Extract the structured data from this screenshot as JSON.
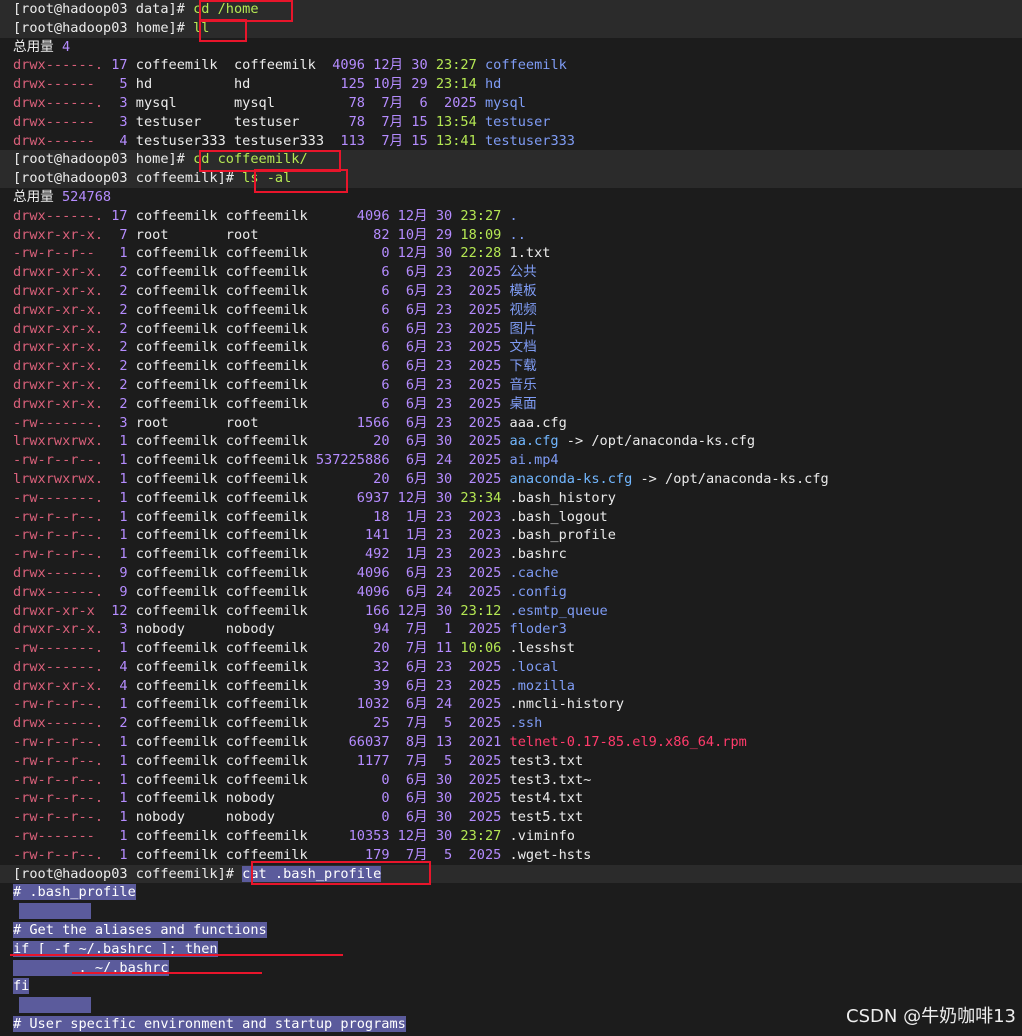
{
  "window": {
    "watermark": "CSDN @牛奶咖啡13"
  },
  "prompt1": {
    "text": "[root@hadoop03 data]# ",
    "cmd": "cd /home"
  },
  "prompt2": {
    "text": "[root@hadoop03 home]# ",
    "cmd": "ll"
  },
  "total1": {
    "label": "总用量",
    "value": "4"
  },
  "home_rows": [
    {
      "perm": "drwx------.",
      "links": "17",
      "user": "coffeemilk",
      "group": "coffeemilk",
      "size": "4096",
      "month": "12月",
      "day": "30",
      "time": "23:27",
      "name": "coffeemilk"
    },
    {
      "perm": "drwx------ ",
      "links": " 5",
      "user": "hd",
      "group": "hd",
      "size": "125",
      "month": "10月",
      "day": "29",
      "time": "23:14",
      "name": "hd"
    },
    {
      "perm": "drwx------.",
      "links": " 3",
      "user": "mysql",
      "group": "mysql",
      "size": "78",
      "month": "7月",
      "day": " 6",
      "time": " 2025",
      "name": "mysql"
    },
    {
      "perm": "drwx------ ",
      "links": " 3",
      "user": "testuser",
      "group": "testuser",
      "size": "78",
      "month": "7月",
      "day": "15",
      "time": "13:54",
      "name": "testuser"
    },
    {
      "perm": "drwx------ ",
      "links": " 4",
      "user": "testuser333",
      "group": "testuser333",
      "size": "113",
      "month": "7月",
      "day": "15",
      "time": "13:41",
      "name": "testuser333"
    }
  ],
  "prompt3": {
    "text": "[root@hadoop03 home]# ",
    "cmd": "cd coffeemilk/"
  },
  "prompt4": {
    "text": "[root@hadoop03 coffeemilk]# ",
    "cmd": "ls -al"
  },
  "total2": {
    "label": "总用量",
    "value": "524768"
  },
  "ls_rows": [
    {
      "perm": "drwx------.",
      "links": "17",
      "user": "coffeemilk",
      "group": "coffeemilk",
      "size": "4096",
      "month": "12月",
      "day": "30",
      "time": "23:27",
      "name": ".",
      "ncolor": "blue",
      "tcolor": "green"
    },
    {
      "perm": "drwxr-xr-x.",
      "links": " 7",
      "user": "root",
      "group": "root",
      "size": "82",
      "month": "10月",
      "day": "29",
      "time": "18:09",
      "name": "..",
      "ncolor": "blue",
      "tcolor": "green"
    },
    {
      "perm": "-rw-r--r--",
      "links": "1",
      "user": "coffeemilk",
      "group": "coffeemilk",
      "size": "0",
      "month": "12月",
      "day": "30",
      "time": "22:28",
      "name": "1.txt",
      "ncolor": "white",
      "tcolor": "green"
    },
    {
      "perm": "drwxr-xr-x.",
      "links": "2",
      "user": "coffeemilk",
      "group": "coffeemilk",
      "size": "6",
      "month": "6月",
      "day": "23",
      "time": "2025",
      "name": "公共",
      "ncolor": "blue",
      "tcolor": "purple"
    },
    {
      "perm": "drwxr-xr-x.",
      "links": "2",
      "user": "coffeemilk",
      "group": "coffeemilk",
      "size": "6",
      "month": "6月",
      "day": "23",
      "time": "2025",
      "name": "模板",
      "ncolor": "blue",
      "tcolor": "purple"
    },
    {
      "perm": "drwxr-xr-x.",
      "links": "2",
      "user": "coffeemilk",
      "group": "coffeemilk",
      "size": "6",
      "month": "6月",
      "day": "23",
      "time": "2025",
      "name": "视频",
      "ncolor": "blue",
      "tcolor": "purple"
    },
    {
      "perm": "drwxr-xr-x.",
      "links": "2",
      "user": "coffeemilk",
      "group": "coffeemilk",
      "size": "6",
      "month": "6月",
      "day": "23",
      "time": "2025",
      "name": "图片",
      "ncolor": "blue",
      "tcolor": "purple"
    },
    {
      "perm": "drwxr-xr-x.",
      "links": "2",
      "user": "coffeemilk",
      "group": "coffeemilk",
      "size": "6",
      "month": "6月",
      "day": "23",
      "time": "2025",
      "name": "文档",
      "ncolor": "blue",
      "tcolor": "purple"
    },
    {
      "perm": "drwxr-xr-x.",
      "links": "2",
      "user": "coffeemilk",
      "group": "coffeemilk",
      "size": "6",
      "month": "6月",
      "day": "23",
      "time": "2025",
      "name": "下载",
      "ncolor": "blue",
      "tcolor": "purple"
    },
    {
      "perm": "drwxr-xr-x.",
      "links": "2",
      "user": "coffeemilk",
      "group": "coffeemilk",
      "size": "6",
      "month": "6月",
      "day": "23",
      "time": "2025",
      "name": "音乐",
      "ncolor": "blue",
      "tcolor": "purple"
    },
    {
      "perm": "drwxr-xr-x.",
      "links": "2",
      "user": "coffeemilk",
      "group": "coffeemilk",
      "size": "6",
      "month": "6月",
      "day": "23",
      "time": "2025",
      "name": "桌面",
      "ncolor": "blue",
      "tcolor": "purple"
    },
    {
      "perm": "-rw-------.",
      "links": "3",
      "user": "root",
      "group": "root",
      "size": "1566",
      "month": "6月",
      "day": "23",
      "time": "2025",
      "name": "aaa.cfg",
      "ncolor": "white",
      "tcolor": "purple"
    },
    {
      "perm": "lrwxrwxrwx.",
      "links": "1",
      "user": "coffeemilk",
      "group": "coffeemilk",
      "size": "20",
      "month": "6月",
      "day": "30",
      "time": "2025",
      "name": "aa.cfg",
      "link": " -> /opt/anaconda-ks.cfg",
      "ncolor": "cyan",
      "tcolor": "purple"
    },
    {
      "perm": "-rw-r--r--.",
      "links": "1",
      "user": "coffeemilk",
      "group": "coffeemilk",
      "size": "537225886",
      "month": "6月",
      "day": "24",
      "time": "2025",
      "name": "ai.mp4",
      "ncolor": "blue",
      "tcolor": "purple"
    },
    {
      "perm": "lrwxrwxrwx.",
      "links": "1",
      "user": "coffeemilk",
      "group": "coffeemilk",
      "size": "20",
      "month": "6月",
      "day": "30",
      "time": "2025",
      "name": "anaconda-ks.cfg",
      "link": " -> /opt/anaconda-ks.cfg",
      "ncolor": "cyan",
      "tcolor": "purple"
    },
    {
      "perm": "-rw-------.",
      "links": "1",
      "user": "coffeemilk",
      "group": "coffeemilk",
      "size": "6937",
      "month": "12月",
      "day": "30",
      "time": "23:34",
      "name": ".bash_history",
      "ncolor": "white",
      "tcolor": "green"
    },
    {
      "perm": "-rw-r--r--.",
      "links": "1",
      "user": "coffeemilk",
      "group": "coffeemilk",
      "size": "18",
      "month": "1月",
      "day": "23",
      "time": "2023",
      "name": ".bash_logout",
      "ncolor": "white",
      "tcolor": "purple"
    },
    {
      "perm": "-rw-r--r--.",
      "links": "1",
      "user": "coffeemilk",
      "group": "coffeemilk",
      "size": "141",
      "month": "1月",
      "day": "23",
      "time": "2023",
      "name": ".bash_profile",
      "ncolor": "white",
      "tcolor": "purple"
    },
    {
      "perm": "-rw-r--r--.",
      "links": "1",
      "user": "coffeemilk",
      "group": "coffeemilk",
      "size": "492",
      "month": "1月",
      "day": "23",
      "time": "2023",
      "name": ".bashrc",
      "ncolor": "white",
      "tcolor": "purple"
    },
    {
      "perm": "drwx------.",
      "links": "9",
      "user": "coffeemilk",
      "group": "coffeemilk",
      "size": "4096",
      "month": "6月",
      "day": "23",
      "time": "2025",
      "name": ".cache",
      "ncolor": "blue",
      "tcolor": "purple"
    },
    {
      "perm": "drwx------.",
      "links": "9",
      "user": "coffeemilk",
      "group": "coffeemilk",
      "size": "4096",
      "month": "6月",
      "day": "24",
      "time": "2025",
      "name": ".config",
      "ncolor": "blue",
      "tcolor": "purple"
    },
    {
      "perm": "drwxr-xr-x",
      "links": "12",
      "user": "coffeemilk",
      "group": "coffeemilk",
      "size": "166",
      "month": "12月",
      "day": "30",
      "time": "23:12",
      "name": ".esmtp_queue",
      "ncolor": "blue",
      "tcolor": "green"
    },
    {
      "perm": "drwxr-xr-x.",
      "links": "3",
      "user": "nobody",
      "group": "nobody",
      "size": "94",
      "month": "7月",
      "day": "1",
      "time": "2025",
      "name": "floder3",
      "ncolor": "blue",
      "tcolor": "purple"
    },
    {
      "perm": "-rw-------.",
      "links": "1",
      "user": "coffeemilk",
      "group": "coffeemilk",
      "size": "20",
      "month": "7月",
      "day": "11",
      "time": "10:06",
      "name": ".lesshst",
      "ncolor": "white",
      "tcolor": "green"
    },
    {
      "perm": "drwx------.",
      "links": "4",
      "user": "coffeemilk",
      "group": "coffeemilk",
      "size": "32",
      "month": "6月",
      "day": "23",
      "time": "2025",
      "name": ".local",
      "ncolor": "blue",
      "tcolor": "purple"
    },
    {
      "perm": "drwxr-xr-x.",
      "links": "4",
      "user": "coffeemilk",
      "group": "coffeemilk",
      "size": "39",
      "month": "6月",
      "day": "23",
      "time": "2025",
      "name": ".mozilla",
      "ncolor": "blue",
      "tcolor": "purple"
    },
    {
      "perm": "-rw-r--r--.",
      "links": "1",
      "user": "coffeemilk",
      "group": "coffeemilk",
      "size": "1032",
      "month": "6月",
      "day": "24",
      "time": "2025",
      "name": ".nmcli-history",
      "ncolor": "white",
      "tcolor": "purple"
    },
    {
      "perm": "drwx------.",
      "links": "2",
      "user": "coffeemilk",
      "group": "coffeemilk",
      "size": "25",
      "month": "7月",
      "day": "5",
      "time": "2025",
      "name": ".ssh",
      "ncolor": "blue",
      "tcolor": "purple"
    },
    {
      "perm": "-rw-r--r--.",
      "links": "1",
      "user": "coffeemilk",
      "group": "coffeemilk",
      "size": "66037",
      "month": "8月",
      "day": "13",
      "time": "2021",
      "name": "telnet-0.17-85.el9.x86_64.rpm",
      "ncolor": "red",
      "tcolor": "purple"
    },
    {
      "perm": "-rw-r--r--.",
      "links": "1",
      "user": "coffeemilk",
      "group": "coffeemilk",
      "size": "1177",
      "month": "7月",
      "day": "5",
      "time": "2025",
      "name": "test3.txt",
      "ncolor": "white",
      "tcolor": "purple"
    },
    {
      "perm": "-rw-r--r--.",
      "links": "1",
      "user": "coffeemilk",
      "group": "coffeemilk",
      "size": "0",
      "month": "6月",
      "day": "30",
      "time": "2025",
      "name": "test3.txt~",
      "ncolor": "white",
      "tcolor": "purple"
    },
    {
      "perm": "-rw-r--r--.",
      "links": "1",
      "user": "coffeemilk",
      "group": "nobody",
      "size": "0",
      "month": "6月",
      "day": "30",
      "time": "2025",
      "name": "test4.txt",
      "ncolor": "white",
      "tcolor": "purple"
    },
    {
      "perm": "-rw-r--r--.",
      "links": "1",
      "user": "nobody",
      "group": "nobody",
      "size": "0",
      "month": "6月",
      "day": "30",
      "time": "2025",
      "name": "test5.txt",
      "ncolor": "white",
      "tcolor": "purple"
    },
    {
      "perm": "-rw-------",
      "links": "1",
      "user": "coffeemilk",
      "group": "coffeemilk",
      "size": "10353",
      "month": "12月",
      "day": "30",
      "time": "23:27",
      "name": ".viminfo",
      "ncolor": "white",
      "tcolor": "green"
    },
    {
      "perm": "-rw-r--r--.",
      "links": "1",
      "user": "coffeemilk",
      "group": "coffeemilk",
      "size": "179",
      "month": "7月",
      "day": "5",
      "time": "2025",
      "name": ".wget-hsts",
      "ncolor": "white",
      "tcolor": "purple"
    }
  ],
  "prompt5": {
    "text": "[root@hadoop03 coffeemilk]# ",
    "cmd": "cat .bash_profile"
  },
  "cat_lines": [
    "# .bash_profile",
    "",
    "# Get the aliases and functions",
    "if [ -f ~/.bashrc ]; then",
    "        . ~/.bashrc",
    "fi",
    "",
    "# User specific environment and startup programs"
  ]
}
